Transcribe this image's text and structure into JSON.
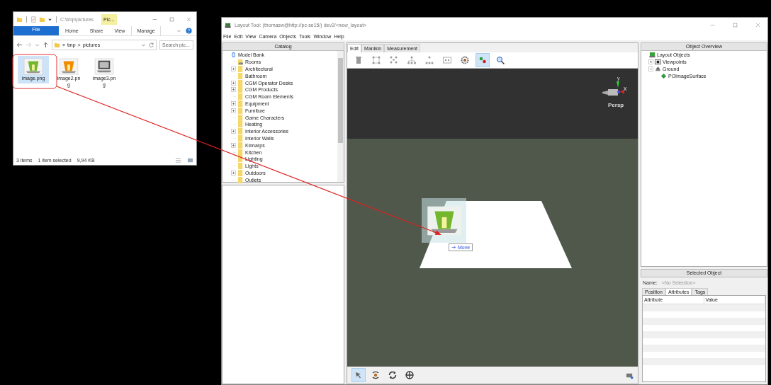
{
  "explorer": {
    "title": "C:\\tmp\\pictures",
    "context_tab": "Pic...",
    "ribbon_tabs": [
      {
        "label": "File",
        "kind": "file"
      },
      {
        "label": "Home",
        "kind": "tab"
      },
      {
        "label": "Share",
        "kind": "tab"
      },
      {
        "label": "View",
        "kind": "tab"
      },
      {
        "label": "Manage",
        "kind": "context"
      }
    ],
    "address": {
      "prefix": "«",
      "separator": ">",
      "crumbs": [
        "tmp",
        "pictures"
      ]
    },
    "search": {
      "placeholder": "Search pic..."
    },
    "files": [
      {
        "name": "image.png",
        "kind": "bucket",
        "color": "#74b72e",
        "selected": true
      },
      {
        "name": "image2.png",
        "kind": "bucket",
        "color": "#f08c00",
        "selected": false
      },
      {
        "name": "image3.png",
        "kind": "screen",
        "selected": false
      }
    ],
    "status": [
      "3 items",
      "1 item selected",
      "9,94 KB"
    ]
  },
  "layout_tool": {
    "title": "Layout Tool: (thomasw@http://pc-se15/) dev2/<new_layout>",
    "menu": [
      "File",
      "Edit",
      "View",
      "Camera",
      "Objects",
      "Tools",
      "Window",
      "Help"
    ],
    "catalog": {
      "header": "Catalog",
      "tree": [
        {
          "label": "Model Bank",
          "kind": "bank",
          "children": [
            {
              "label": "Rooms",
              "kind": "room",
              "expandable": false
            },
            {
              "label": "Architectural",
              "kind": "folder",
              "expandable": true
            },
            {
              "label": "Bathroom",
              "kind": "folder",
              "expandable": false
            },
            {
              "label": "CGM Operator Desks",
              "kind": "folder",
              "expandable": true
            },
            {
              "label": "CGM Products",
              "kind": "folder",
              "expandable": true
            },
            {
              "label": "CGM Room Elements",
              "kind": "folder",
              "expandable": false
            },
            {
              "label": "Equipment",
              "kind": "folder",
              "expandable": true
            },
            {
              "label": "Furniture",
              "kind": "folder",
              "expandable": true
            },
            {
              "label": "Game Characters",
              "kind": "folder",
              "expandable": false
            },
            {
              "label": "Heating",
              "kind": "folder",
              "expandable": false
            },
            {
              "label": "Interior Accessories",
              "kind": "folder",
              "expandable": true
            },
            {
              "label": "Interior Walls",
              "kind": "folder",
              "expandable": false
            },
            {
              "label": "Kinnarps",
              "kind": "folder",
              "expandable": true
            },
            {
              "label": "Kitchen",
              "kind": "folder",
              "expandable": false
            },
            {
              "label": "Lighting",
              "kind": "folder",
              "expandable": false
            },
            {
              "label": "Lights",
              "kind": "folder",
              "expandable": false
            },
            {
              "label": "Outdoors",
              "kind": "folder",
              "expandable": true
            },
            {
              "label": "Outlets",
              "kind": "folder",
              "expandable": false
            }
          ]
        }
      ]
    },
    "viewport": {
      "tabs": [
        {
          "label": "Edit",
          "selected": true
        },
        {
          "label": "Manikin",
          "selected": false
        },
        {
          "label": "Measurement",
          "selected": false
        }
      ],
      "toolbar": [
        {
          "kind": "delete",
          "active": false
        },
        {
          "kind": "group",
          "active": false
        },
        {
          "kind": "ungroup",
          "active": false
        },
        {
          "kind": "hierarchy",
          "active": false
        },
        {
          "kind": "spread",
          "active": false
        },
        {
          "kind": "frame",
          "active": false
        },
        {
          "kind": "settings",
          "active": false
        },
        {
          "kind": "dots",
          "active": true
        },
        {
          "kind": "zoom",
          "active": false
        }
      ],
      "axes": {
        "y_label": "y",
        "x_label": "x",
        "projection": "Persp"
      },
      "tooltip": "Move",
      "bottom_tools": [
        {
          "kind": "select",
          "active": true
        },
        {
          "kind": "orbit",
          "active": false
        },
        {
          "kind": "rotate",
          "active": false
        },
        {
          "kind": "move",
          "active": false
        }
      ]
    },
    "object_overview": {
      "header": "Object Overview",
      "tree": [
        {
          "label": "Layout Objects",
          "kind": "layout",
          "children": [
            {
              "label": "Viewpoints",
              "kind": "camera",
              "expanded": false
            },
            {
              "label": "Ground",
              "kind": "ground",
              "expanded": true,
              "children": [
                {
                  "label": "POImageSurface",
                  "kind": "surface"
                }
              ]
            }
          ]
        }
      ]
    },
    "selected_object": {
      "header": "Selected Object",
      "name_label": "Name:",
      "name_value": "<No Selection>",
      "tabs": [
        {
          "label": "Position",
          "selected": false
        },
        {
          "label": "Attributes",
          "selected": true
        },
        {
          "label": "Tags",
          "selected": false
        }
      ],
      "columns": [
        "Attribute",
        "Value"
      ]
    }
  }
}
